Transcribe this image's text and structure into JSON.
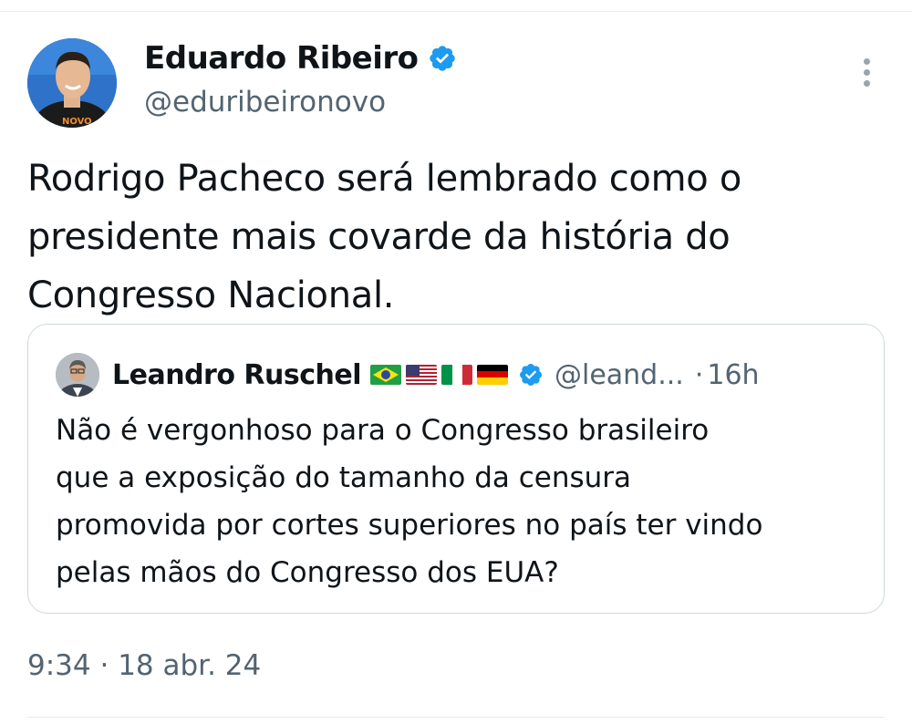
{
  "tweet": {
    "author": {
      "display_name": "Eduardo Ribeiro",
      "handle": "@eduribeironovo",
      "verified": true,
      "avatar_shirt_text": "NOVO"
    },
    "text_lines": [
      "Rodrigo Pacheco será lembrado como o",
      "presidente mais covarde da história do",
      "Congresso Nacional."
    ],
    "time": "9:34",
    "date": "18 abr. 24"
  },
  "quoted_tweet": {
    "author": {
      "display_name": "Leandro Ruschel",
      "flags": [
        "brazil-flag",
        "usa-flag",
        "italy-flag",
        "germany-flag"
      ],
      "verified": true,
      "handle": "@leand..."
    },
    "age": "16h",
    "text_lines": [
      "Não é vergonhoso para o Congresso brasileiro",
      "que a exposição do tamanho da censura",
      "promovida por cortes superiores no país ter vindo",
      "pelas mãos do Congresso dos EUA?"
    ]
  },
  "icons": {
    "verified": "verified-badge-icon",
    "more": "more-vertical-icon"
  },
  "colors": {
    "verified_blue": "#1d9bf0",
    "secondary_text": "#536471",
    "border": "#cfd9de"
  }
}
